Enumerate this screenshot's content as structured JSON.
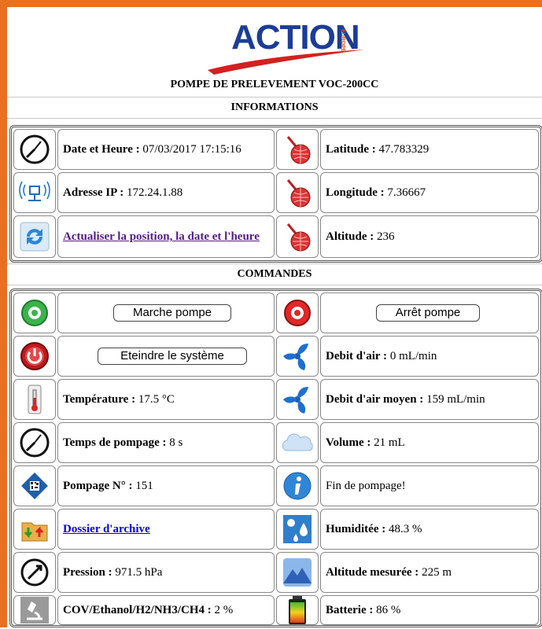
{
  "logo": {
    "text": "ACTION",
    "sub": "EUROPE"
  },
  "page_title": "POMPE DE PRELEVEMENT VOC-200CC",
  "sections": {
    "informations": "INFORMATIONS",
    "commandes": "COMMANDES"
  },
  "info": {
    "date": {
      "label": "Date et Heure :",
      "value": "07/03/2017 17:15:16"
    },
    "latitude": {
      "label": "Latitude :",
      "value": "47.783329"
    },
    "ip": {
      "label": "Adresse IP :",
      "value": "172.24.1.88"
    },
    "longitude": {
      "label": "Longitude :",
      "value": "7.36667"
    },
    "refresh_link": "Actualiser la position, la date et l'heure",
    "altitude": {
      "label": "Altitude :",
      "value": "236"
    }
  },
  "commands": {
    "start_button": "Marche pompe",
    "stop_button": "Arrêt pompe",
    "shutdown_button": "Eteindre le système",
    "airflow": {
      "label": "Debit d'air :",
      "value": "0 mL/min"
    },
    "temperature": {
      "label": "Température :",
      "value": "17.5 °C"
    },
    "airflow_avg": {
      "label": "Debit d'air moyen :",
      "value": "159 mL/min"
    },
    "pump_time": {
      "label": "Temps de pompage :",
      "value": "8 s"
    },
    "volume": {
      "label": "Volume :",
      "value": "21 mL"
    },
    "pump_number": {
      "label": "Pompage N° :",
      "value": "151"
    },
    "status": "Fin de pompage!",
    "archive_link": "Dossier d'archive",
    "humidity": {
      "label": "Humiditée :",
      "value": "48.3 %"
    },
    "pressure": {
      "label": "Pression :",
      "value": "971.5 hPa"
    },
    "altitude_measured": {
      "label": "Altitude mesurée :",
      "value": "225 m"
    },
    "voc": {
      "label": "COV/Ethanol/H2/NH3/CH4 :",
      "value": "2 %"
    },
    "battery": {
      "label": "Batterie :",
      "value": "86 %"
    }
  },
  "colors": {
    "frame": "#e8701e",
    "logo_blue": "#1c3d96",
    "logo_swoosh": "#d42020"
  }
}
